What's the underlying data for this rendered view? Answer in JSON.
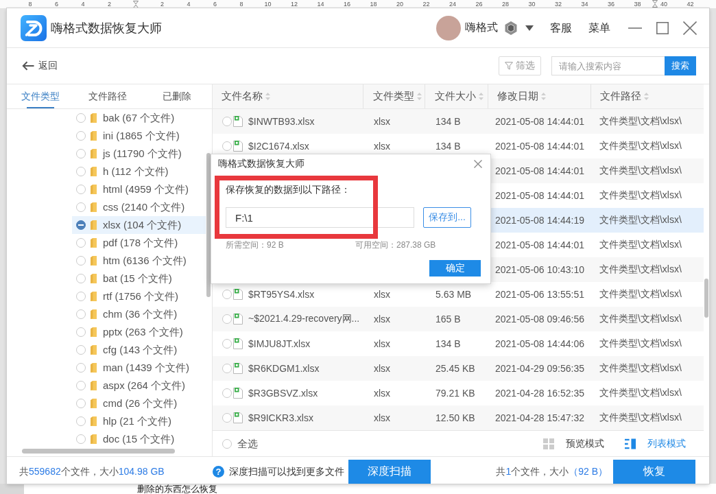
{
  "ruler": {
    "left_labels": [
      "8",
      "6",
      "4",
      "2"
    ],
    "right_labels": [
      "2",
      "4",
      "6",
      "8",
      "10",
      "12",
      "14",
      "16",
      "18",
      "20",
      "22",
      "24",
      "26",
      "28",
      "30",
      "32",
      "34",
      "36",
      "38",
      "40",
      "42"
    ]
  },
  "window": {
    "title": "嗨格式数据恢复大师",
    "user": {
      "name": "嗨格式"
    },
    "menu": [
      "客服",
      "菜单"
    ]
  },
  "toolbar": {
    "back": "返回",
    "filter": "筛选",
    "search": {
      "placeholder": "请输入搜索内容",
      "button": "搜索"
    }
  },
  "sidebar": {
    "tabs": [
      {
        "label": "文件类型",
        "selected": true
      },
      {
        "label": "文件路径",
        "selected": false
      },
      {
        "label": "已删除",
        "selected": false
      }
    ],
    "items": [
      {
        "label": "bak (67 个文件)",
        "selected": false,
        "partial": false
      },
      {
        "label": "ini (1865 个文件)",
        "selected": false,
        "partial": false
      },
      {
        "label": "js (11790 个文件)",
        "selected": false,
        "partial": false
      },
      {
        "label": "h (112 个文件)",
        "selected": false,
        "partial": false
      },
      {
        "label": "html (4959 个文件)",
        "selected": false,
        "partial": false
      },
      {
        "label": "css (2140 个文件)",
        "selected": false,
        "partial": false
      },
      {
        "label": "xlsx (104 个文件)",
        "selected": true,
        "partial": true
      },
      {
        "label": "pdf (178 个文件)",
        "selected": false,
        "partial": false
      },
      {
        "label": "htm (6136 个文件)",
        "selected": false,
        "partial": false
      },
      {
        "label": "bat (15 个文件)",
        "selected": false,
        "partial": false
      },
      {
        "label": "rtf (1756 个文件)",
        "selected": false,
        "partial": false
      },
      {
        "label": "chm (36 个文件)",
        "selected": false,
        "partial": false
      },
      {
        "label": "pptx (263 个文件)",
        "selected": false,
        "partial": false
      },
      {
        "label": "cfg (143 个文件)",
        "selected": false,
        "partial": false
      },
      {
        "label": "man (1439 个文件)",
        "selected": false,
        "partial": false
      },
      {
        "label": "aspx (264 个文件)",
        "selected": false,
        "partial": false
      },
      {
        "label": "cmd (26 个文件)",
        "selected": false,
        "partial": false
      },
      {
        "label": "hlp (21 个文件)",
        "selected": false,
        "partial": false
      },
      {
        "label": "doc (15 个文件)",
        "selected": false,
        "partial": false
      }
    ]
  },
  "table": {
    "columns": [
      "文件名称",
      "文件类型",
      "文件大小",
      "修改日期",
      "文件路径"
    ],
    "rows": [
      {
        "name": "$INWTB93.xlsx",
        "type": "xlsx",
        "size": "134 B",
        "date": "2021-05-08 14:44:01",
        "path": "文件类型\\文档\\xlsx\\",
        "checked": false,
        "selected": false
      },
      {
        "name": "$I2C1674.xlsx",
        "type": "xlsx",
        "size": "134 B",
        "date": "2021-05-08 14:44:01",
        "path": "文件类型\\文档\\xlsx\\",
        "checked": false,
        "selected": false
      },
      {
        "date": "2021-05-08 14:44:01",
        "path": "文件类型\\文档\\xlsx\\",
        "selected": false
      },
      {
        "date": "2021-05-08 14:44:01",
        "path": "文件类型\\文档\\xlsx\\",
        "selected": false
      },
      {
        "date": "2021-05-08 14:44:19",
        "path": "文件类型\\文档\\xlsx\\",
        "selected": true
      },
      {
        "date": "2021-05-08 14:44:01",
        "path": "文件类型\\文档\\xlsx\\",
        "selected": false
      },
      {
        "date": "2021-05-06 10:43:10",
        "path": "文件类型\\文档\\xlsx\\",
        "selected": false
      },
      {
        "name": "$RT95YS4.xlsx",
        "type": "xlsx",
        "size": "5.63 MB",
        "date": "2021-05-06 13:55:51",
        "path": "文件类型\\文档\\xlsx\\",
        "checked": false,
        "selected": false
      },
      {
        "name": "~$2021.4.29-recovery网...",
        "type": "xlsx",
        "size": "165 B",
        "date": "2021-05-08 09:46:56",
        "path": "文件类型\\文档\\xlsx\\",
        "checked": false,
        "selected": false
      },
      {
        "name": "$IMJU8JT.xlsx",
        "type": "xlsx",
        "size": "134 B",
        "date": "2021-05-08 14:44:06",
        "path": "文件类型\\文档\\xlsx\\",
        "checked": false,
        "selected": false
      },
      {
        "name": "$R6KDGM1.xlsx",
        "type": "xlsx",
        "size": "25.45 KB",
        "date": "2021-04-29 09:56:35",
        "path": "文件类型\\文档\\xlsx\\",
        "checked": false,
        "selected": false
      },
      {
        "name": "$R3GBSVZ.xlsx",
        "type": "xlsx",
        "size": "79.21 KB",
        "date": "2021-04-28 16:52:35",
        "path": "文件类型\\文档\\xlsx\\",
        "checked": false,
        "selected": false
      },
      {
        "name": "$R9ICKR3.xlsx",
        "type": "xlsx",
        "size": "12.50 KB",
        "date": "2021-04-28 15:47:32",
        "path": "文件类型\\文档\\xlsx\\",
        "checked": false,
        "selected": false
      }
    ]
  },
  "table_footer": {
    "select_all": {
      "label": "全选",
      "checked": false
    },
    "view_modes": [
      {
        "label": "预览模式",
        "kind": "grid",
        "selected": false
      },
      {
        "label": "列表模式",
        "kind": "list",
        "selected": true
      }
    ]
  },
  "status_bar": {
    "summary": [
      {
        "text": "共",
        "highlight": false
      },
      {
        "text": "559682",
        "highlight": true
      },
      {
        "text": "个文件，大小",
        "highlight": false
      },
      {
        "text": "104.98 GB",
        "highlight": true
      }
    ],
    "help_icon": "?",
    "hint": "深度扫描可以找到更多文件",
    "deep_scan": "深度扫描",
    "selection": [
      {
        "text": "共",
        "highlight": false
      },
      {
        "text": "1",
        "highlight": true
      },
      {
        "text": "个文件，大小",
        "highlight": false
      },
      {
        "text": "（92 B）",
        "highlight": true
      }
    ],
    "recover": "恢复"
  },
  "dialog": {
    "title": "嗨格式数据恢复大师",
    "prompt": "保存恢复的数据到以下路径：",
    "path_field": {
      "value": "F:\\1"
    },
    "browse": "保存到...",
    "required": "所需空间：92 B",
    "available": "可用空间：287.38 GB",
    "confirm": "确定",
    "annotation": {
      "kind": "rectangle"
    }
  },
  "document": {
    "text": "删除的东西怎么恢复"
  }
}
